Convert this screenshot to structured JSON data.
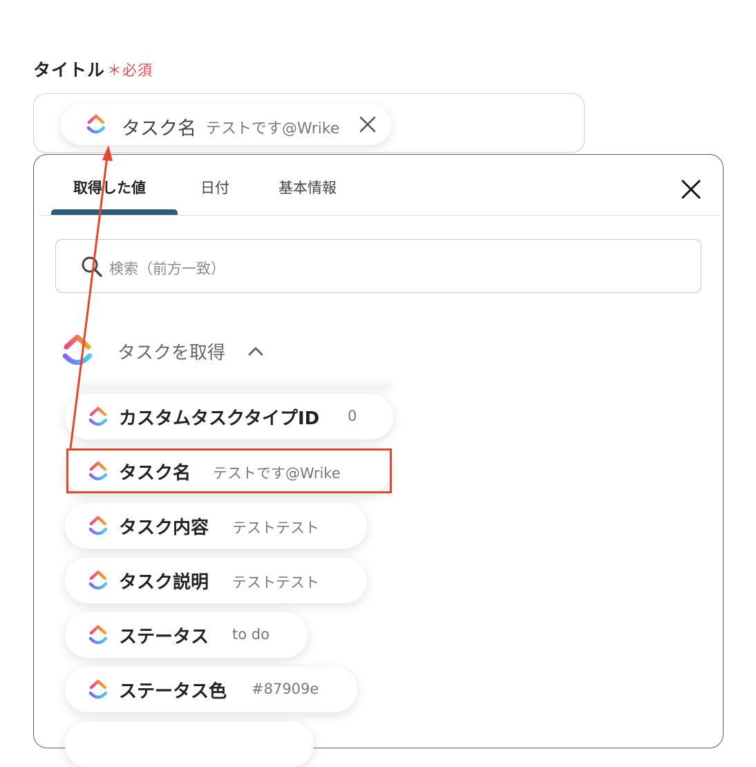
{
  "field": {
    "label": "タイトル",
    "required": "＊必須"
  },
  "input_chip": {
    "icon": "clickup-icon",
    "name": "タスク名",
    "value": "テストです@Wrike",
    "close_icon": "close-icon"
  },
  "panel": {
    "tabs": [
      {
        "label": "取得した値",
        "active": true
      },
      {
        "label": "日付",
        "active": false
      },
      {
        "label": "基本情報",
        "active": false
      }
    ],
    "close_icon": "close-icon",
    "search": {
      "icon": "search-icon",
      "placeholder": "検索（前方一致）"
    },
    "group": {
      "icon": "clickup-icon",
      "title": "タスクを取得",
      "expand_icon": "chevron-up-icon"
    },
    "items": [
      {
        "name": "カスタムタスクタイプID",
        "value": "0"
      },
      {
        "name": "タスク名",
        "value": "テストです@Wrike",
        "highlighted": true
      },
      {
        "name": "タスク内容",
        "value": "テストテスト"
      },
      {
        "name": "タスク説明",
        "value": "テストテスト"
      },
      {
        "name": "ステータス",
        "value": "to do"
      },
      {
        "name": "ステータス色",
        "value": "#87909e"
      }
    ]
  },
  "colors": {
    "required": "#e5484d",
    "tab_active_underline": "#2e5b77",
    "annotation": "#e8442a",
    "clickup_gradient": [
      "#f5a623",
      "#e84a8a",
      "#7b68ee"
    ]
  }
}
